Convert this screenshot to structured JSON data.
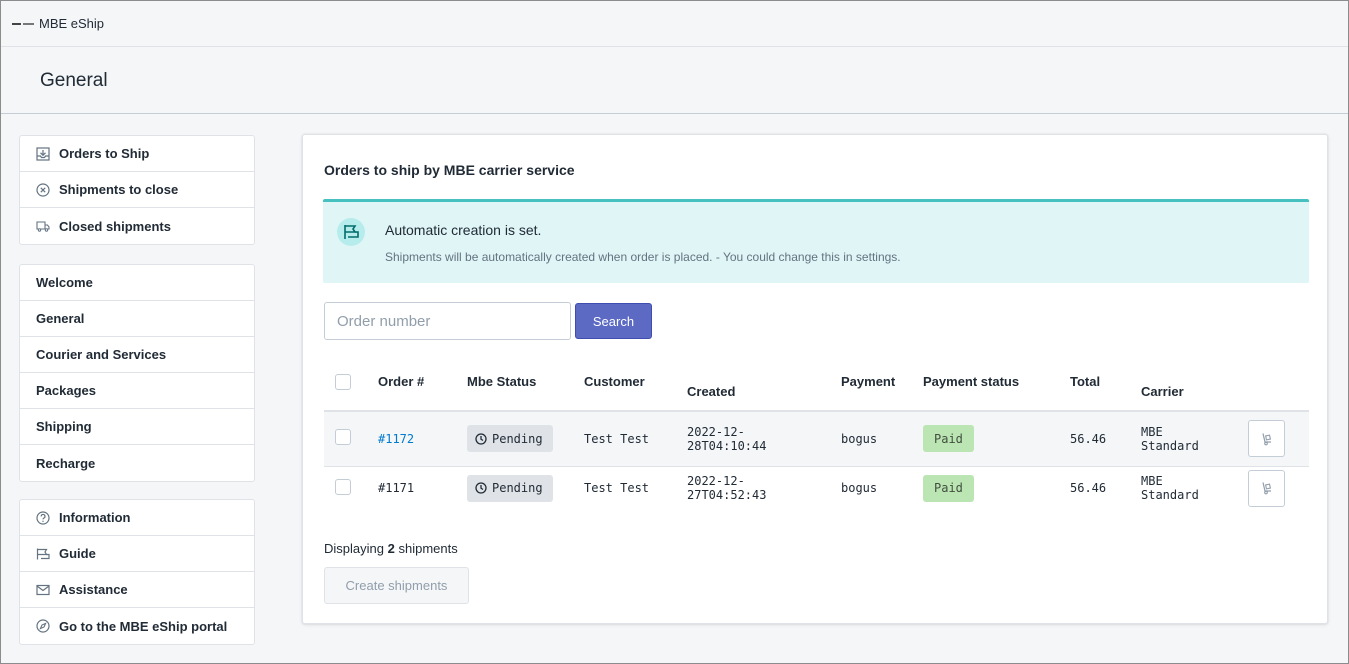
{
  "app": {
    "title": "MBE eShip"
  },
  "page": {
    "title": "General"
  },
  "sidebar": {
    "group1": [
      {
        "label": "Orders to Ship",
        "icon": "download-tray-icon"
      },
      {
        "label": "Shipments to close",
        "icon": "circle-x-icon"
      },
      {
        "label": "Closed shipments",
        "icon": "truck-icon"
      }
    ],
    "group2": [
      {
        "label": "Welcome"
      },
      {
        "label": "General"
      },
      {
        "label": "Courier and Services"
      },
      {
        "label": "Packages"
      },
      {
        "label": "Shipping"
      },
      {
        "label": "Recharge"
      }
    ],
    "group3": [
      {
        "label": "Information",
        "icon": "question-circle-icon"
      },
      {
        "label": "Guide",
        "icon": "flag-icon"
      },
      {
        "label": "Assistance",
        "icon": "envelope-icon"
      },
      {
        "label": "Go to the MBE eShip portal",
        "icon": "compass-icon"
      }
    ]
  },
  "main": {
    "title": "Orders to ship by MBE carrier service",
    "banner": {
      "title": "Automatic creation is set.",
      "text": "Shipments will be automatically created when order is placed. - You could change this in settings."
    },
    "search": {
      "placeholder": "Order number",
      "button": "Search"
    },
    "table": {
      "headers": {
        "order": "Order #",
        "mbe_status": "Mbe Status",
        "customer": "Customer",
        "created": "Created",
        "payment": "Payment",
        "payment_status": "Payment status",
        "total": "Total",
        "carrier": "Carrier"
      },
      "rows": [
        {
          "order": "#1172",
          "mbe_status": "Pending",
          "customer": "Test Test",
          "created_line1": "2022-12-",
          "created_line2": "28T04:10:44",
          "payment": "bogus",
          "payment_status": "Paid",
          "total": "56.46",
          "carrier_line1": "MBE",
          "carrier_line2": "Standard"
        },
        {
          "order": "#1171",
          "mbe_status": "Pending",
          "customer": "Test Test",
          "created_line1": "2022-12-",
          "created_line2": "27T04:52:43",
          "payment": "bogus",
          "payment_status": "Paid",
          "total": "56.46",
          "carrier_line1": "MBE",
          "carrier_line2": "Standard"
        }
      ]
    },
    "display": {
      "prefix": "Displaying",
      "count": "2",
      "suffix": "shipments"
    },
    "create_button": "Create shipments"
  },
  "colors": {
    "accent": "#5c6ac4",
    "banner_bg": "#e0f5f5",
    "banner_border": "#47c1bf",
    "link": "#007ace",
    "paid_badge": "#bbe5b3",
    "pending_badge": "#dfe3e8"
  }
}
